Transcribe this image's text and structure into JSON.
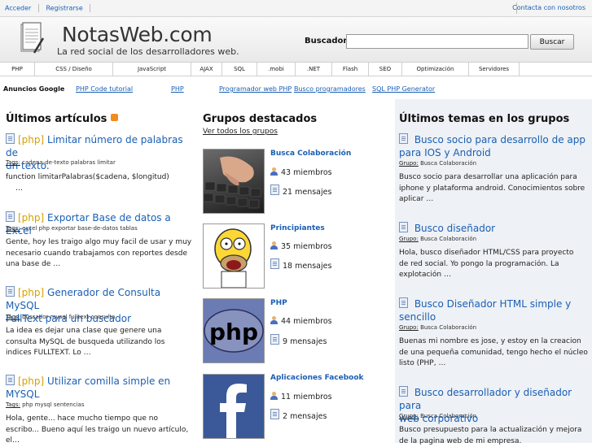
{
  "topbar": {
    "login": "Acceder",
    "register": "Registrarse",
    "contact": "Contacta con nosotros"
  },
  "header": {
    "title": "NotasWeb.com",
    "tagline": "La red social de los desarrolladores web.",
    "search_label": "Buscador:",
    "search_value": "",
    "search_button": "Buscar"
  },
  "nav": [
    "PHP",
    "CSS / Diseño",
    "JavaScript",
    "AJAX",
    "SQL",
    ".mobi",
    ".NET",
    "Flash",
    "SEO",
    "Optimización",
    "Servidores"
  ],
  "ads": {
    "label": "Anuncios Google",
    "links": [
      "PHP Code tutorial",
      "PHP",
      "Programador web PHP",
      "Busco programadores",
      "SQL PHP Generator"
    ]
  },
  "articles": {
    "title": "Últimos artículos",
    "rss_icon": "rss-icon",
    "items": [
      {
        "tag": "[php]",
        "title_l1": "Limitar número de palabras de",
        "title_l2": "un texto.",
        "tags": "cadena-de-texto palabras limitar",
        "excerpt_l1": "function limitarPalabras($cadena, $longitud)",
        "excerpt_l2": "…",
        "excerpt_l3": ""
      },
      {
        "tag": "[php]",
        "title_l1": "Exportar Base de datos a Excel",
        "title_l2": "",
        "tags": "excel php exportar base-de-datos tablas",
        "excerpt_l1": "Gente, hoy les traigo algo muy facil de usar y muy",
        "excerpt_l2": "necesario cuando trabajamos con reportes desde",
        "excerpt_l3": "una base de …"
      },
      {
        "tag": "[php]",
        "title_l1": "Generador de Consulta MySQL",
        "title_l2": "FullText para un buscador",
        "tags": "buscador mysql fulltext consulta",
        "excerpt_l1": "La idea es dejar una clase que genere una",
        "excerpt_l2": "consulta MySQL de busqueda utilizando los",
        "excerpt_l3": "indices FULLTEXT. Lo …"
      },
      {
        "tag": "[php]",
        "title_l1": "Utilizar comilla simple en",
        "title_l2": "MYSQL",
        "tags": "php mysql sentencias",
        "excerpt_l1": "Hola, gente... hace mucho tiempo que no",
        "excerpt_l2": "escribo... Bueno aquí les traigo un nuevo artículo,",
        "excerpt_l3": "el…"
      }
    ],
    "tags_label": "Tags:"
  },
  "groups": {
    "title": "Grupos destacados",
    "see_all": "Ver todos los grupos",
    "items": [
      {
        "name": "Busca Colaboración",
        "members": "43 miembros",
        "messages": "21 mensajes"
      },
      {
        "name": "Principiantes",
        "members": "35 miembros",
        "messages": "18 mensajes"
      },
      {
        "name": "PHP",
        "members": "44 miembros",
        "messages": "9 mensajes"
      },
      {
        "name": "Aplicaciones Facebook",
        "members": "11 miembros",
        "messages": "2 mensajes"
      }
    ]
  },
  "topics": {
    "title": "Últimos temas en los grupos",
    "group_label": "Grupo:",
    "items": [
      {
        "title_l1": "Busco socio para desarrollo de app",
        "title_l2": "para IOS y Android",
        "group": "Busca Colaboración",
        "excerpt_l1": "Busco socio para desarrollar una aplicación para",
        "excerpt_l2": "iphone y plataforma android. Conocimientos sobre",
        "excerpt_l3": "aplicar …"
      },
      {
        "title_l1": "Busco diseñador",
        "title_l2": "",
        "group": "Busca Colaboración",
        "excerpt_l1": "Hola, busco diseñador HTML/CSS para proyecto",
        "excerpt_l2": "de red social. Yo pongo la programación. La",
        "excerpt_l3": "explotación …"
      },
      {
        "title_l1": "Busco Diseñador HTML simple y",
        "title_l2": "sencillo",
        "group": "Busca Colaboración",
        "excerpt_l1": "Buenas mi nombre es jose, y estoy en la creacion",
        "excerpt_l2": "de una pequeña comunidad, tengo hecho el núcleo",
        "excerpt_l3": "listo (PHP, …"
      },
      {
        "title_l1": "Busco desarrollador y diseñador para",
        "title_l2": "web corporativo",
        "group": "Busca Colaboración",
        "excerpt_l1": "Busco presupuesto para la actualización y mejora",
        "excerpt_l2": "de la pagina web de mi empresa.",
        "excerpt_l3": ""
      }
    ]
  }
}
